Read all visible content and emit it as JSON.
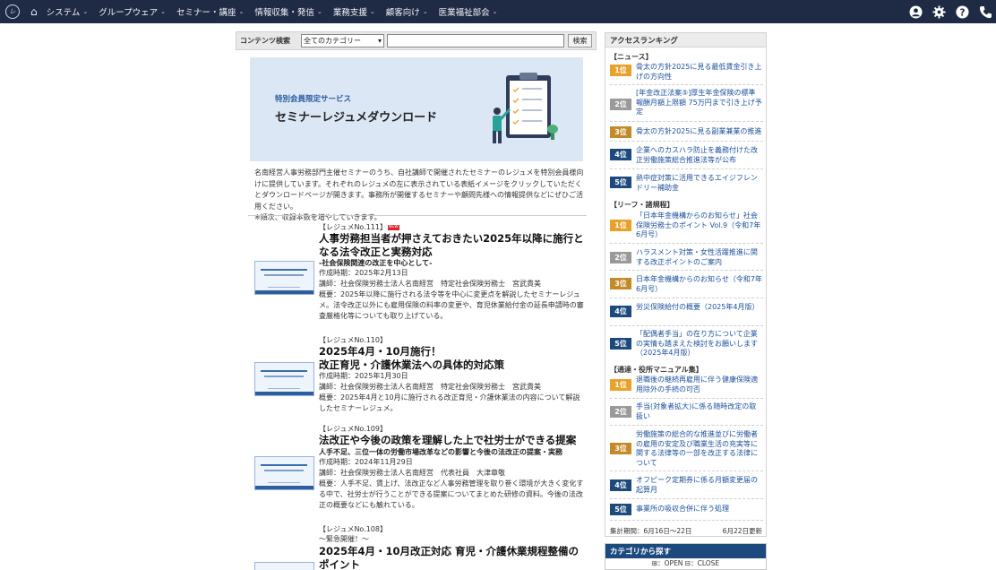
{
  "nav": {
    "logo": "レ",
    "items": [
      "システム",
      "グループウェア",
      "セミナー・講座",
      "情報収集・発信",
      "業務支援",
      "顧客向け",
      "医業福祉部会"
    ]
  },
  "search": {
    "label": "コンテンツ検索",
    "category_selected": "全てのカテゴリー",
    "button": "検索"
  },
  "banner": {
    "small": "特別会員限定サービス",
    "title": "セミナーレジュメダウンロード"
  },
  "intro": {
    "text": "名南経営人事労務部門主催セミナーのうち、自社講師で開催されたセミナーのレジュメを特別会員様向けに提供しています。それぞれのレジュメの左に表示されている表紙イメージをクリックしていただくとダウンロードページが開きます。事務所が開催するセミナーや顧問先様への情報提供などにぜひご活用ください。",
    "note": "※順次、収録本数を増やしていきます。"
  },
  "resumes": [
    {
      "no": "【レジュメNo.111】",
      "new": "NEW",
      "title": "人事労務担当者が押さえておきたい2025年以降に施行となる法令改正と実務対応",
      "subtitle": "-社会保険関連の改正を中心として-",
      "date": "作成時期：2025年2月13日",
      "lecturer": "講師：社会保険労務士法人名南経営　特定社会保険労務士　宮武貴美",
      "summary": "概要：2025年以降に施行される法令等を中心に変更点を解説したセミナーレジュメ。法令改正以外にも雇用保険の料率の変更や、育児休業給付金の延長申請時の審査厳格化等についても取り上げている。"
    },
    {
      "no": "【レジュメNo.110】",
      "title": "2025年4月・10月施行！\n改正育児・介護休業法への具体的対応策",
      "date": "作成時期：2025年1月30日",
      "lecturer": "講師：社会保険労務士法人名南経営　特定社会保険労務士　宮武貴美",
      "summary": "概要：2025年4月と10月に施行される改正育児・介護休業法の内容について解説したセミナーレジュメ。"
    },
    {
      "no": "【レジュメNo.109】",
      "title": "法改正や今後の政策を理解した上で社労士ができる提案",
      "subtitle": "人手不足、三位一体の労働市場改革などの影響と今後の法改正の提案・実務",
      "date": "作成時期：2024年11月29日",
      "lecturer": "講師：社会保険労務士法人名南経営　代表社員　大津章敬",
      "summary": "概要：人手不足、賃上げ、法改正など人事労務管理を取り巻く環境が大きく変化する中で、社労士が行うことができる提案についてまとめた研修の資料。今後の法改正の概要などにも触れている。"
    },
    {
      "no": "【レジュメNo.108】",
      "subtitle": "～緊急開催！～",
      "title": "2025年4月・10月改正対応 育児・介護休業規程整備のポイント"
    }
  ],
  "ranking": {
    "header": "アクセスランキング",
    "categories": [
      {
        "name": "【ニュース】",
        "items": [
          {
            "rank": "1位",
            "text": "骨太の方針2025に見る最低賃金引き上げの方向性"
          },
          {
            "rank": "2位",
            "text": "[年金改正法案⑤]厚生年金保険の標準報酬月額上限額 75万円まで引き上げ予定"
          },
          {
            "rank": "3位",
            "text": "骨太の方針2025に見る副業兼業の推進"
          },
          {
            "rank": "4位",
            "text": "企業へのカスハラ防止を義務付けた改正労働施策総合推進法等が公布"
          },
          {
            "rank": "5位",
            "text": "熱中症対策に活用できるエイジフレンドリー補助金"
          }
        ]
      },
      {
        "name": "【リーフ・諸規程】",
        "items": [
          {
            "rank": "1位",
            "text": "「日本年金機構からのお知らせ」社会保険労務士のポイント Vol.9（令和7年6月号）"
          },
          {
            "rank": "2位",
            "text": "ハラスメント対策・女性活躍推進に関する改正ポイントのご案内"
          },
          {
            "rank": "3位",
            "text": "日本年金機構からのお知らせ（令和7年6月号）"
          },
          {
            "rank": "4位",
            "text": "労災保険給付の概要（2025年4月版）"
          },
          {
            "rank": "5位",
            "text": "「配偶者手当」の在り方について企業の実情も踏まえた検討をお願いします（2025年4月版）"
          }
        ]
      },
      {
        "name": "【通達・役所マニュアル集】",
        "items": [
          {
            "rank": "1位",
            "text": "退職後の継続再雇用に伴う健康保険適用除外の手続の可否"
          },
          {
            "rank": "2位",
            "text": "手当(対象者拡大)に係る随時改定の取扱い"
          },
          {
            "rank": "3位",
            "text": "労働施策の総合的な推進並びに労働者の雇用の安定及び職業生活の充実等に関する法律等の一部を改正する法律について"
          },
          {
            "rank": "4位",
            "text": "オフピーク定期券に係る月額変更届の起算月"
          },
          {
            "rank": "5位",
            "text": "事業所の吸収合併に伴う処理"
          }
        ]
      }
    ],
    "period": "集計期間：6月16日～22日",
    "updated": "6月22日更新"
  },
  "category_box": {
    "header": "カテゴリから探す",
    "openclose": "⊞：OPEN ⊟：CLOSE"
  },
  "colors": {
    "nav_bg": "#1f2a44",
    "rank_gold": "#e8a22b",
    "rank_gray": "#9a9a9a",
    "rank_blue": "#1d4a7e",
    "link": "#1a4f9c"
  }
}
